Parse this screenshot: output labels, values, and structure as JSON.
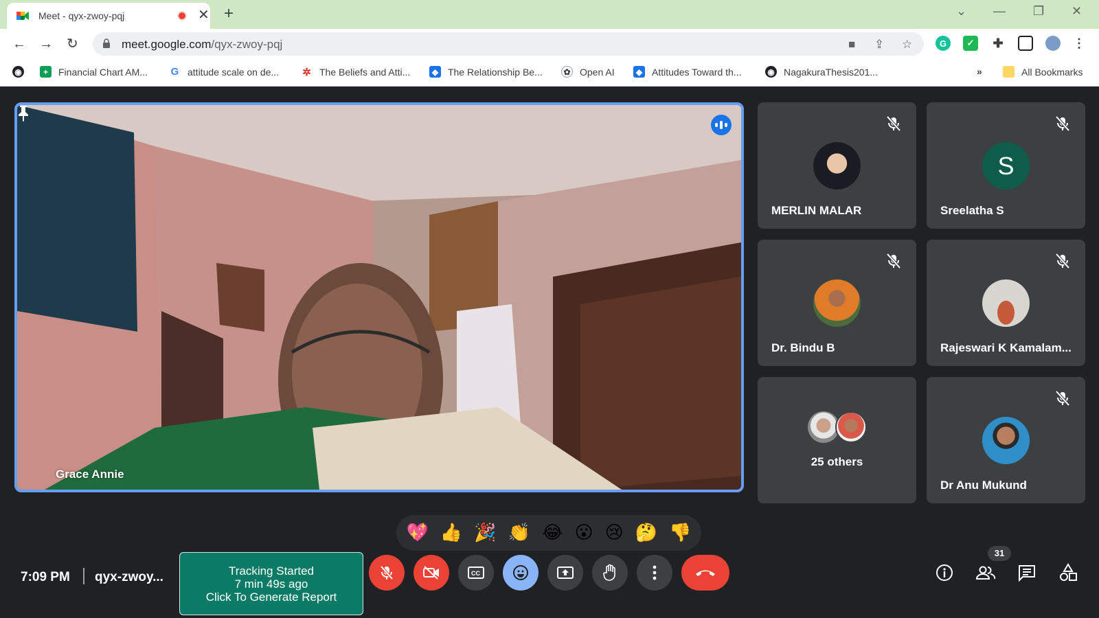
{
  "browser": {
    "tab_title": "Meet - qyx-zwoy-pqj",
    "url_host": "meet.google.com",
    "url_path": "/qyx-zwoy-pqj",
    "bookmarks": [
      {
        "label": "Financial Chart AM...",
        "icon": "google-sheets-icon"
      },
      {
        "label": "attitude scale on de...",
        "icon": "google-icon"
      },
      {
        "label": "The Beliefs and Atti...",
        "icon": "dots-icon"
      },
      {
        "label": "The Relationship Be...",
        "icon": "dropbox-icon"
      },
      {
        "label": "Open AI",
        "icon": "openai-icon"
      },
      {
        "label": "Attitudes Toward th...",
        "icon": "dropbox-icon"
      },
      {
        "label": "NagakuraThesis201...",
        "icon": "globe-icon"
      }
    ],
    "overflow_label": "»",
    "all_bookmarks_label": "All Bookmarks"
  },
  "meet": {
    "main_speaker": "Grace Annie",
    "participants": [
      {
        "name": "MERLIN MALAR",
        "avatar": "photo"
      },
      {
        "name": "Sreelatha S",
        "avatar_letter": "S"
      },
      {
        "name": "Dr. Bindu B",
        "avatar": "photo"
      },
      {
        "name": "Rajeswari K Kamalam...",
        "avatar": "photo"
      },
      {
        "name": "Dr Anu Mukund",
        "avatar": "photo"
      }
    ],
    "others_label": "25 others",
    "reactions": [
      "💖",
      "👍",
      "🎉",
      "👏",
      "😂",
      "😮",
      "😢",
      "🤔",
      "👎"
    ],
    "clock": "7:09 PM",
    "meeting_code": "qyx-zwoy...",
    "tracking": {
      "line1": "Tracking Started",
      "line2": "7 min 49s ago",
      "line3": "Click To Generate Report"
    },
    "people_count": "31",
    "colors": {
      "background": "#202124",
      "tile": "#3c4043",
      "active_border": "#669df6",
      "danger": "#ea4335",
      "tracking": "#0b7b67"
    }
  }
}
